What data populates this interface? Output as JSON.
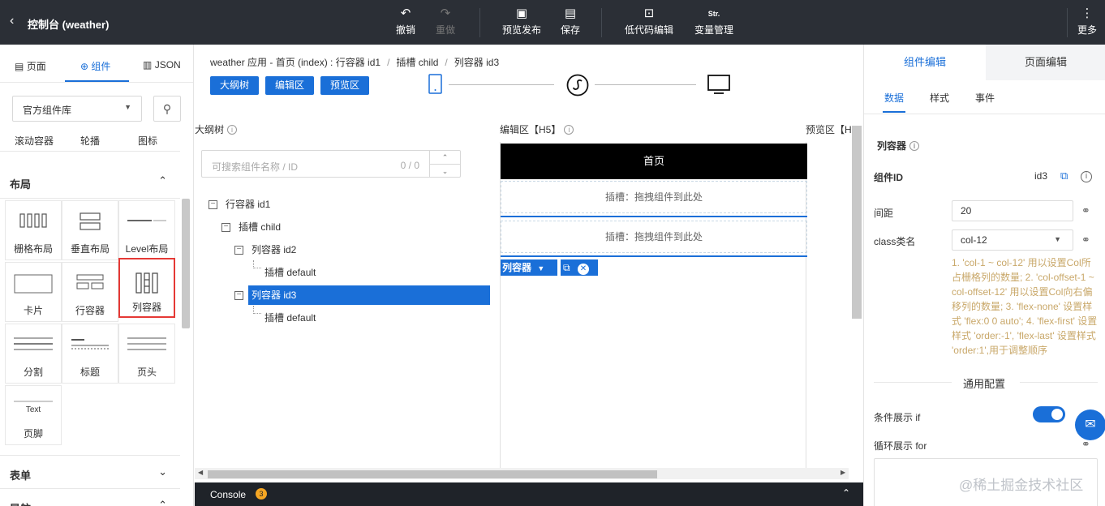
{
  "topbar": {
    "title": "控制台 (weather)",
    "buttons": [
      {
        "label": "撤销",
        "icon": "undo-icon",
        "glyph": "↶"
      },
      {
        "label": "重做",
        "icon": "redo-icon",
        "glyph": "↷"
      },
      {
        "label": "预览发布",
        "icon": "preview-icon",
        "glyph": "▣"
      },
      {
        "label": "保存",
        "icon": "save-icon",
        "glyph": "▤"
      },
      {
        "label": "低代码编辑",
        "icon": "code-edit-icon",
        "glyph": "⊡"
      },
      {
        "label": "变量管理",
        "icon": "variable-icon",
        "glyph": "Str."
      },
      {
        "label": "更多",
        "icon": "more-icon",
        "glyph": "⋮"
      }
    ]
  },
  "left": {
    "tabs": [
      {
        "label": "页面",
        "icon": "▤"
      },
      {
        "label": "组件",
        "icon": "⊕"
      },
      {
        "label": "JSON",
        "icon": "▥"
      }
    ],
    "library_select": "官方组件库",
    "top_row": [
      "滚动容器",
      "轮播",
      "图标"
    ],
    "sections": {
      "layout": "布局",
      "form": "表单",
      "nav": "导航"
    },
    "layout_items": [
      "栅格布局",
      "垂直布局",
      "Level布局",
      "卡片",
      "行容器",
      "列容器",
      "分割",
      "标题",
      "页头",
      "页脚"
    ],
    "footer_text": "Text"
  },
  "middle": {
    "breadcrumb": [
      "weather 应用 - 首页 (index) : 行容器 id1",
      "插槽 child",
      "列容器 id3"
    ],
    "mode_buttons": [
      "大纲树",
      "编辑区",
      "预览区"
    ],
    "headers": {
      "outline": "大纲树",
      "editor": "编辑区【H5】",
      "preview": "预览区【H"
    },
    "search": {
      "placeholder": "可搜索组件名称 / ID",
      "count": "0 / 0"
    },
    "tree": [
      {
        "label": "行容器 id1"
      },
      {
        "label": "插槽 child"
      },
      {
        "label": "列容器 id2"
      },
      {
        "label": "插槽 default"
      },
      {
        "label": "列容器 id3"
      },
      {
        "label": "插槽 default"
      }
    ],
    "canvas": {
      "page_title": "首页",
      "slot_text": "插槽：拖拽组件到此处",
      "tag_label": "列容器"
    },
    "console": {
      "label": "Console",
      "badge": "3"
    }
  },
  "right": {
    "tabs": [
      "组件编辑",
      "页面编辑"
    ],
    "subtabs": [
      "数据",
      "样式",
      "事件"
    ],
    "component_name": "列容器",
    "id_label": "组件ID",
    "id_value": "id3",
    "gap_label": "间距",
    "gap_value": "20",
    "class_label": "class类名",
    "class_value": "col-12",
    "help": "1. 'col-1 ~ col-12' 用以设置Col所占栅格列的数量; 2. 'col-offset-1 ~ col-offset-12' 用以设置Col向右偏移列的数量; 3. 'flex-none' 设置样式 'flex:0 0 auto'; 4. 'flex-first' 设置样式 'order:-1', 'flex-last' 设置样式 'order:1',用于调整顺序",
    "general_config": "通用配置",
    "if_label": "条件展示 if",
    "if_enabled": true,
    "for_label": "循环展示 for"
  },
  "watermark": "@稀土掘金技术社区",
  "colors": {
    "accent": "#1a6fd8",
    "topbar": "#2b2f36",
    "selection": "#e53935"
  }
}
